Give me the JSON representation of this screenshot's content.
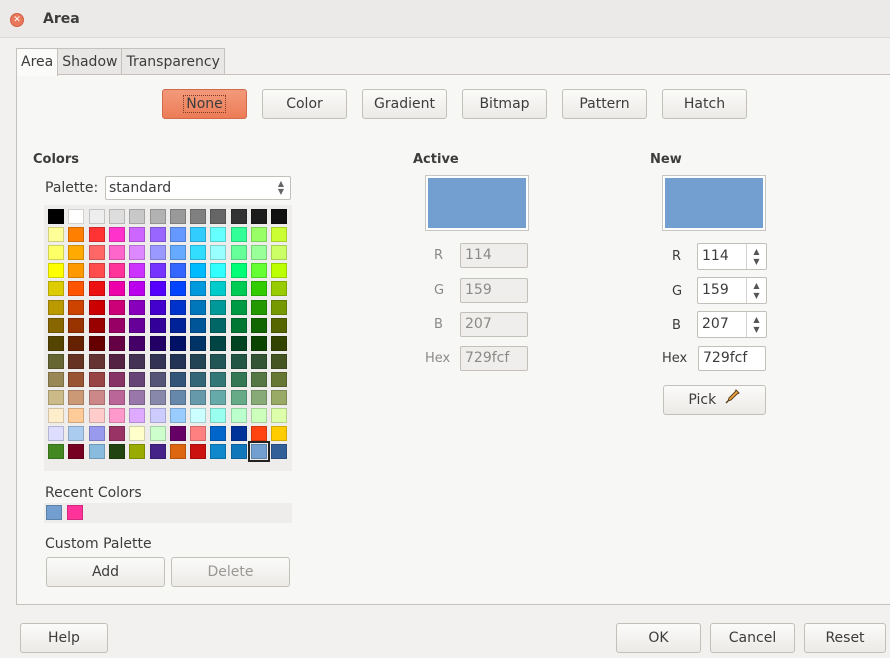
{
  "window": {
    "title": "Area"
  },
  "tabs": [
    "Area",
    "Shadow",
    "Transparency"
  ],
  "fill_buttons": [
    "None",
    "Color",
    "Gradient",
    "Bitmap",
    "Pattern",
    "Hatch"
  ],
  "colors": {
    "title": "Colors",
    "palette_label": "Palette:",
    "palette_value": "standard",
    "grid": [
      [
        "#000000",
        "#ffffff",
        "#eeeeee",
        "#dddddd",
        "#c8c8c8",
        "#b2b2b2",
        "#999999",
        "#808080",
        "#666666",
        "#333333",
        "#1c1c1c",
        "#111111"
      ],
      [
        "#ffff99",
        "#ff8000",
        "#ff3333",
        "#ff33cc",
        "#cc66ff",
        "#9966ff",
        "#6699ff",
        "#33ccff",
        "#66ffff",
        "#33ff99",
        "#99ff66",
        "#ccff33"
      ],
      [
        "#ffff66",
        "#ffaa00",
        "#ff6666",
        "#ff66cc",
        "#dd88ff",
        "#9999ff",
        "#66aaff",
        "#33ddff",
        "#99ffff",
        "#66ff99",
        "#99ff99",
        "#ccff66"
      ],
      [
        "#ffff00",
        "#ff9900",
        "#ff4d4d",
        "#ff3399",
        "#cc33ff",
        "#7733ff",
        "#3366ff",
        "#00bbff",
        "#33ffff",
        "#00ff77",
        "#66ff33",
        "#bbff00"
      ],
      [
        "#ddcc00",
        "#ff5500",
        "#ee1111",
        "#ee00aa",
        "#bb00ee",
        "#5500ff",
        "#0044ff",
        "#0099dd",
        "#00cccc",
        "#00cc55",
        "#33cc00",
        "#99cc00"
      ],
      [
        "#bb9900",
        "#cc4400",
        "#cc0000",
        "#cc0077",
        "#8800bb",
        "#4400cc",
        "#0033cc",
        "#0077bb",
        "#009999",
        "#009944",
        "#229900",
        "#779900"
      ],
      [
        "#886600",
        "#993300",
        "#990000",
        "#990066",
        "#660099",
        "#330099",
        "#002299",
        "#005599",
        "#006666",
        "#007733",
        "#116600",
        "#556600"
      ],
      [
        "#554400",
        "#662200",
        "#660000",
        "#660044",
        "#440066",
        "#220066",
        "#001166",
        "#003366",
        "#004444",
        "#004422",
        "#0a4400",
        "#334400"
      ],
      [
        "#666633",
        "#663322",
        "#663333",
        "#552244",
        "#443355",
        "#333355",
        "#223355",
        "#224455",
        "#225555",
        "#225544",
        "#335533",
        "#445522"
      ],
      [
        "#998855",
        "#995533",
        "#994444",
        "#883366",
        "#664477",
        "#555577",
        "#335577",
        "#336677",
        "#337777",
        "#337755",
        "#557744",
        "#667733"
      ],
      [
        "#ccbb88",
        "#cc9977",
        "#cc8888",
        "#bb6699",
        "#9977aa",
        "#8888aa",
        "#6688aa",
        "#6699aa",
        "#66aaaa",
        "#66aa88",
        "#88aa77",
        "#99aa66"
      ],
      [
        "#ffeecc",
        "#ffcc99",
        "#ffcccc",
        "#ff99cc",
        "#ddaaff",
        "#ccccff",
        "#99ccff",
        "#ccffff",
        "#99ffee",
        "#bbffcc",
        "#ccffbb",
        "#ddffaa"
      ],
      [
        "#ddddff",
        "#aaccee",
        "#9999ee",
        "#993366",
        "#ffffcc",
        "#ccffcc",
        "#660066",
        "#ff8080",
        "#0066cc",
        "#003399",
        "#ff4411",
        "#ffcc00"
      ],
      [
        "#448822",
        "#770022",
        "#88bbdd",
        "#224411",
        "#99aa00",
        "#442288",
        "#dd6611",
        "#cc1111",
        "#1188cc",
        "#1177bb",
        "#729fcf",
        "#335f99"
      ]
    ],
    "recent_label": "Recent Colors",
    "recent": [
      "#729fcf",
      "#ff3399"
    ],
    "custom_label": "Custom Palette",
    "add": "Add",
    "delete": "Delete"
  },
  "active": {
    "title": "Active",
    "color": "#729fcf",
    "r_label": "R",
    "r": "114",
    "g_label": "G",
    "g": "159",
    "b_label": "B",
    "b": "207",
    "hex_label": "Hex",
    "hex": "729fcf"
  },
  "new": {
    "title": "New",
    "color": "#729fcf",
    "r_label": "R",
    "r": "114",
    "g_label": "G",
    "g": "159",
    "b_label": "B",
    "b": "207",
    "hex_label": "Hex",
    "hex": "729fcf",
    "pick": "Pick"
  },
  "footer": {
    "help": "Help",
    "ok": "OK",
    "cancel": "Cancel",
    "reset": "Reset"
  }
}
